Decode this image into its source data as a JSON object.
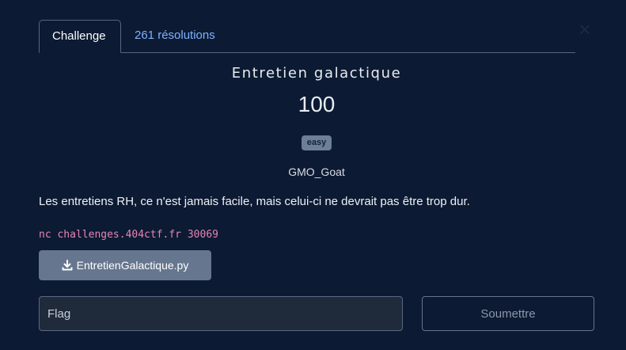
{
  "tabs": [
    {
      "label": "Challenge",
      "active": true
    },
    {
      "label": "261 résolutions",
      "active": false
    }
  ],
  "close_icon": "close-icon",
  "challenge": {
    "title": "Entretien galactique",
    "points": "100",
    "difficulty": "easy",
    "author": "GMO_Goat",
    "description": "Les entretiens RH, ce n'est jamais facile, mais celui-ci ne devrait pas être trop dur.",
    "connection": "nc challenges.404ctf.fr 30069"
  },
  "download": {
    "icon": "download-icon",
    "label": "EntretienGalactique.py"
  },
  "flag_form": {
    "placeholder": "Flag",
    "submit_label": "Soumettre"
  },
  "colors": {
    "background": "#0c1a33",
    "link": "#7eb2ff",
    "badge": "#6d7f97",
    "code": "#e685b5",
    "download_button": "#66768f"
  }
}
